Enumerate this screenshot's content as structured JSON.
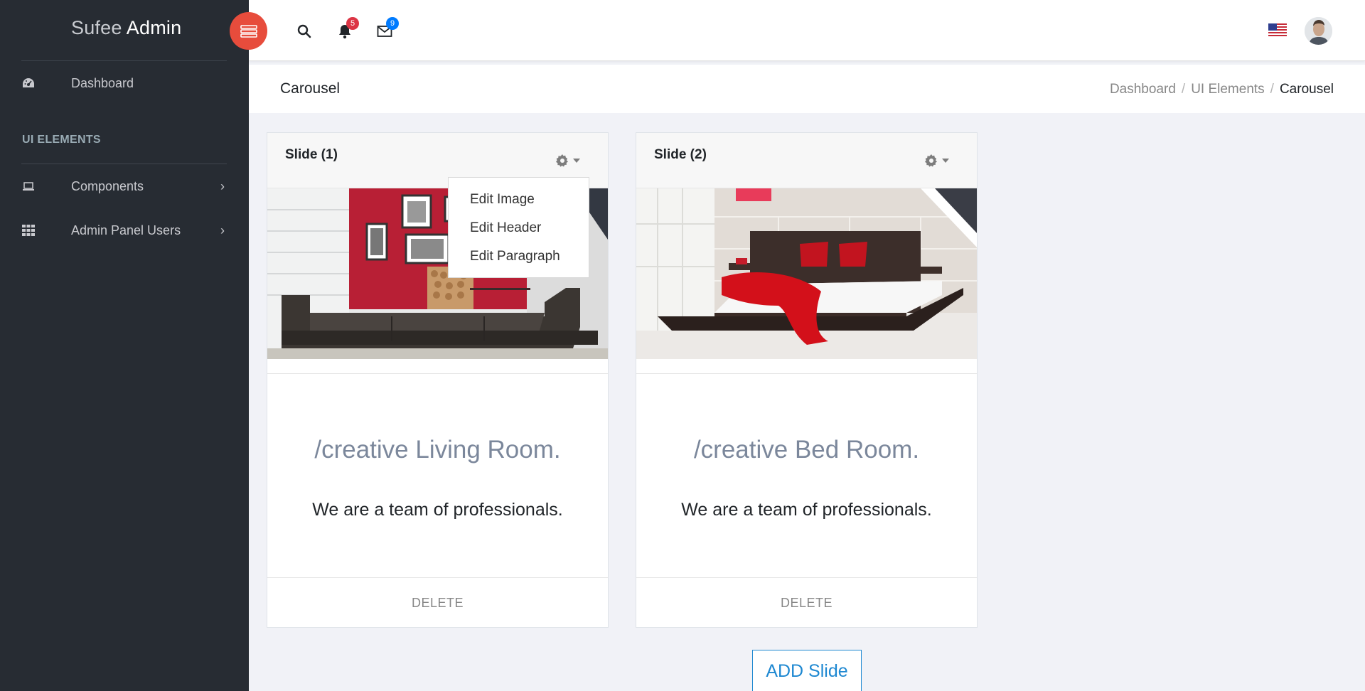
{
  "brand": {
    "light": "Sufee",
    "bold": "Admin"
  },
  "sidebar": {
    "items": [
      {
        "label": "Dashboard",
        "icon": "dashboard-icon"
      },
      {
        "label": "Components",
        "icon": "laptop-icon"
      },
      {
        "label": "Admin Panel Users",
        "icon": "grid-icon"
      }
    ],
    "section": "UI ELEMENTS"
  },
  "header": {
    "notifications_count": "5",
    "messages_count": "9",
    "colors": {
      "menu_toggle": "#e74c3c",
      "notif_badge": "#dc3545",
      "msg_badge": "#007bff"
    }
  },
  "page": {
    "title": "Carousel",
    "breadcrumb": [
      "Dashboard",
      "UI Elements",
      "Carousel"
    ]
  },
  "slides": [
    {
      "title": "Slide (1)",
      "heading": "/creative Living Room.",
      "paragraph": "We are a team of professionals.",
      "delete_label": "DELETE"
    },
    {
      "title": "Slide (2)",
      "heading": "/creative Bed Room.",
      "paragraph": "We are a team of professionals.",
      "delete_label": "DELETE"
    }
  ],
  "dropdown": [
    "Edit Image",
    "Edit Header",
    "Edit Paragraph"
  ],
  "add_slide_label": "ADD Slide"
}
